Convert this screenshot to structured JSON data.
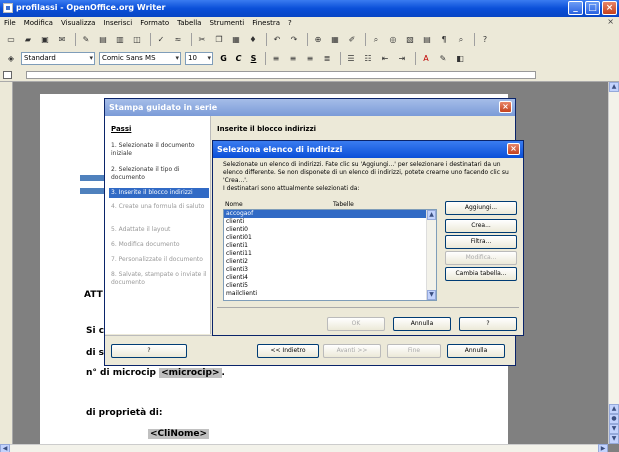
{
  "window": {
    "title": "profilassi - OpenOffice.org Writer",
    "controls": [
      "_",
      "□",
      "×"
    ]
  },
  "menu": {
    "items": [
      "File",
      "Modifica",
      "Visualizza",
      "Inserisci",
      "Formato",
      "Tabella",
      "Strumenti",
      "Finestra",
      "?"
    ],
    "close_doc": "×"
  },
  "formatting": {
    "style": "Standard",
    "font": "Comic Sans MS",
    "size": "10",
    "bold": "G",
    "italic": "C",
    "underline": "S"
  },
  "document": {
    "lines": [
      {
        "id": "att",
        "text": "ATT"
      },
      {
        "id": "si",
        "text": "Si c"
      },
      {
        "id": "dis",
        "text": "di s"
      },
      {
        "id": "microcip_label",
        "text": "n° di microcip"
      },
      {
        "id": "proprieta",
        "text": "di proprietà di:"
      }
    ],
    "fields": {
      "microcip": "<microcip>",
      "clinome": "<CliNome>"
    },
    "microcip_trailing": "."
  },
  "wizard": {
    "title": "Stampa guidato in serie",
    "steps_header": "Passi",
    "current_step_title": "Inserite il blocco indirizzi",
    "steps": [
      {
        "label": "1. Selezionate il documento iniziale",
        "state": "normal"
      },
      {
        "label": "2. Selezionate il tipo di documento",
        "state": "normal"
      },
      {
        "label": "3. Inserite il blocco indirizzi",
        "state": "active"
      },
      {
        "label": "4. Create una formula di saluto",
        "state": "disabled"
      },
      {
        "label": "5. Adattate il layout",
        "state": "disabled"
      },
      {
        "label": "6. Modifica documento",
        "state": "disabled"
      },
      {
        "label": "7. Personalizzate il documento",
        "state": "disabled"
      },
      {
        "label": "8. Salvate, stampate o inviate il documento",
        "state": "disabled"
      }
    ],
    "buttons": {
      "help": "?",
      "back": "<< Indietro",
      "next": "Avanti >>",
      "finish": "Fine",
      "cancel": "Annulla"
    }
  },
  "select_dialog": {
    "title": "Seleziona elenco di indirizzi",
    "description": "Selezionate un elenco di indirizzi. Fate clic su 'Aggiungi...' per selezionare i destinatari da un elenco differente. Se non disponete di un elenco di indirizzi, potete crearne uno facendo clic su 'Crea...'.",
    "label": "I destinatari sono attualmente selezionati da:",
    "columns": [
      "Nome",
      "Tabelle"
    ],
    "items": [
      "accogaof",
      "clienti",
      "clienti0",
      "clienti01",
      "clienti1",
      "clienti11",
      "clienti2",
      "clienti3",
      "clienti4",
      "clienti5",
      "mailclienti"
    ],
    "selected_index": 0,
    "buttons": {
      "add": "Aggiungi...",
      "create": "Crea...",
      "filter": "Filtra...",
      "modify": "Modifica...",
      "change_table": "Cambia tabella...",
      "ok": "OK",
      "cancel": "Annulla",
      "help": "?"
    }
  }
}
